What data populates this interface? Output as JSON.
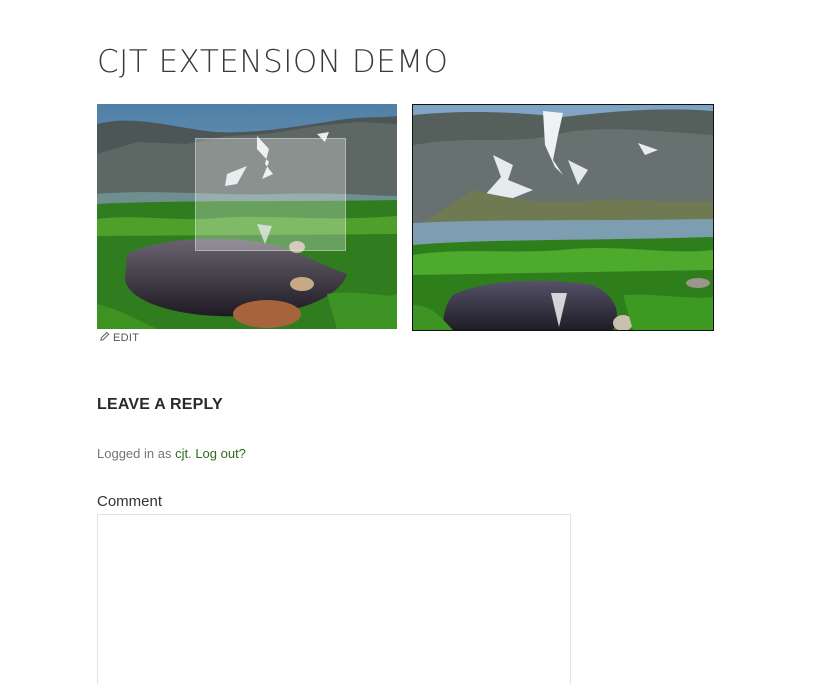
{
  "page": {
    "title": "CJT EXTENSION DEMO"
  },
  "gallery": {
    "images": [
      {
        "alt": "mountain lake with zoom lens overlay",
        "icon": "landscape-thumbnail"
      },
      {
        "alt": "zoomed mountain lake view",
        "icon": "landscape-zoom-view"
      }
    ],
    "edit_label": "EDIT",
    "edit_icon": "pencil-icon"
  },
  "reply": {
    "title": "LEAVE A REPLY",
    "logged_in_prefix": "Logged in as ",
    "user_name": "cjt",
    "separator": ". ",
    "logout_label": "Log out?",
    "comment_label": "Comment",
    "comment_value": ""
  },
  "colors": {
    "link": "#2d6a1f",
    "muted_text": "#767676",
    "title_text": "#3a3a3a"
  }
}
